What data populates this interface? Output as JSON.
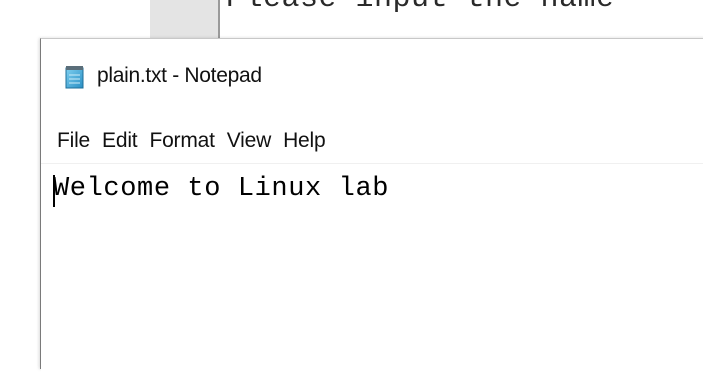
{
  "background_window": {
    "visible_text": "Please input the name"
  },
  "notepad": {
    "title": "plain.txt - Notepad",
    "icon": "notepad-icon",
    "menu": [
      {
        "label": "File"
      },
      {
        "label": "Edit"
      },
      {
        "label": "Format"
      },
      {
        "label": "View"
      },
      {
        "label": "Help"
      }
    ],
    "content": "Welcome to Linux lab"
  }
}
